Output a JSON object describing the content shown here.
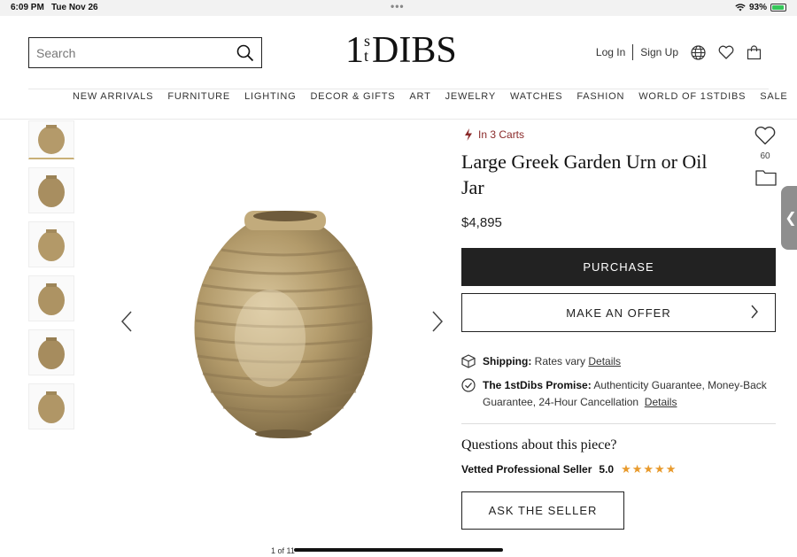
{
  "status_bar": {
    "time": "6:09 PM",
    "date": "Tue Nov 26",
    "battery": "93%",
    "battery_level": 0.93
  },
  "header": {
    "search_placeholder": "Search",
    "logo_sup_top": "s",
    "logo_sup_bottom": "t",
    "logo_one": "1",
    "logo_text": "DIBS",
    "login": "Log In",
    "signup": "Sign Up"
  },
  "nav": {
    "items": [
      "NEW ARRIVALS",
      "FURNITURE",
      "LIGHTING",
      "DECOR & GIFTS",
      "ART",
      "JEWELRY",
      "WATCHES",
      "FASHION",
      "WORLD OF 1STDIBS",
      "SALE"
    ]
  },
  "gallery": {
    "thumbnail_count": 6,
    "pager": "1 of 11"
  },
  "product": {
    "carts": "In 3 Carts",
    "title": "Large Greek Garden Urn or Oil Jar",
    "price": "$4,895",
    "favorites_count": "60",
    "purchase_label": "PURCHASE",
    "offer_label": "MAKE AN OFFER",
    "shipping_label": "Shipping:",
    "shipping_text": "Rates vary",
    "shipping_link": "Details",
    "promise_label": "The 1stDibs Promise:",
    "promise_text": "Authenticity Guarantee, Money-Back Guarantee, 24-Hour Cancellation",
    "promise_link": "Details",
    "questions": "Questions about this piece?",
    "seller_label": "Vetted Professional Seller",
    "seller_rating": "5.0",
    "stars": "★★★★★",
    "ask_label": "ASK THE SELLER"
  },
  "colors": {
    "accent_dark": "#222222",
    "carts_red": "#8a2a2a",
    "star_orange": "#e89a2c"
  }
}
